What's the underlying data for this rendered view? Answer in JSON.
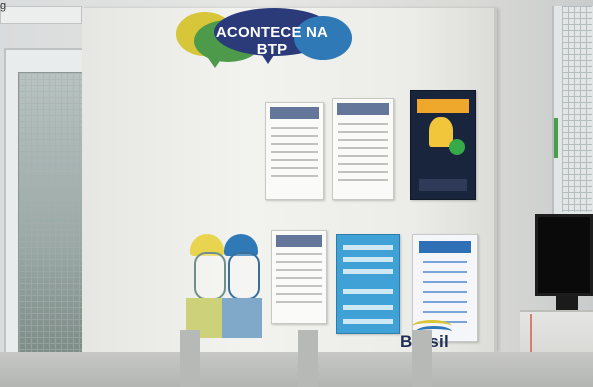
{
  "scene": {
    "description_tags": [
      "notice-board",
      "posters",
      "worker-illustration",
      "door",
      "window",
      "monitor"
    ]
  },
  "board": {
    "speech_bubble_text": "ACONTECE NA BTP",
    "logo_text": "Brasil",
    "corner_text": "g"
  },
  "colors": {
    "yellow": "#d7c53a",
    "green": "#4d9a4a",
    "navy": "#2b3b7a",
    "blue": "#2f79b6",
    "poster_dark": "#19253c",
    "poster_blue": "#3fa1d6"
  }
}
